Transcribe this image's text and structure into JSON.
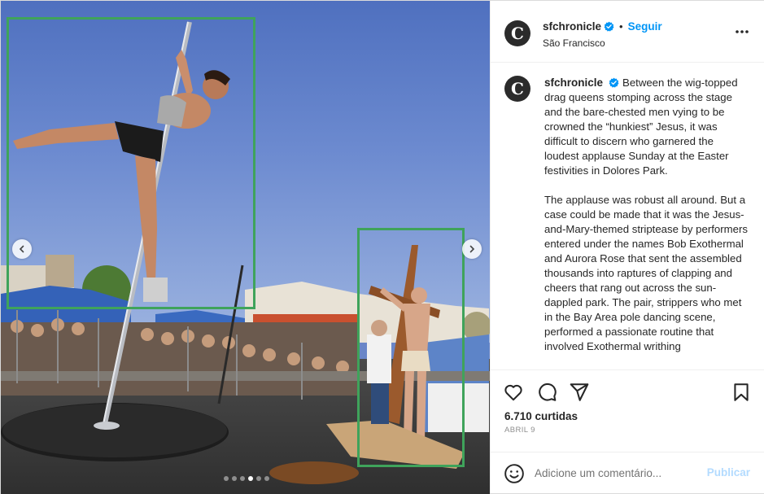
{
  "post": {
    "username": "sfchronicle",
    "follow_label": "Seguir",
    "bullet": "•",
    "location": "São Francisco",
    "avatar_letter": "C",
    "caption_paragraphs": [
      "Between the wig-topped drag queens stomping across the stage and the bare-chested men vying to be crowned the “hunkiest” Jesus, it was difficult to discern who garnered the loudest applause Sunday at the Easter festivities in Dolores Park.",
      "The applause was robust all around. But a case could be made that it was the Jesus-and-Mary-themed striptease by performers entered under the names Bob Exothermal and Aurora Rose that sent the assembled thousands into raptures of clapping and cheers that rang out across the sun-dappled park. The pair, strippers who met in the Bay Area pole dancing scene, performed a passionate routine that involved Exothermal writhing"
    ],
    "likes": "6.710 curtidas",
    "date": "ABRIL 9"
  },
  "comment": {
    "placeholder": "Adicione um comentário...",
    "publish_label": "Publicar"
  },
  "carousel": {
    "slide_count": 6,
    "active_index": 3
  },
  "icons": {
    "verified": "verified-badge-icon",
    "more": "more-options-icon",
    "like": "heart-icon",
    "comment": "comment-bubble-icon",
    "share": "paper-plane-icon",
    "save": "bookmark-icon",
    "emoji": "smiley-icon",
    "prev": "chevron-left-icon",
    "next": "chevron-right-icon"
  },
  "colors": {
    "accent": "#0095f6",
    "publish_disabled": "#b3dbff",
    "verified": "#0095f6",
    "detection_box": "#3fa35b"
  }
}
